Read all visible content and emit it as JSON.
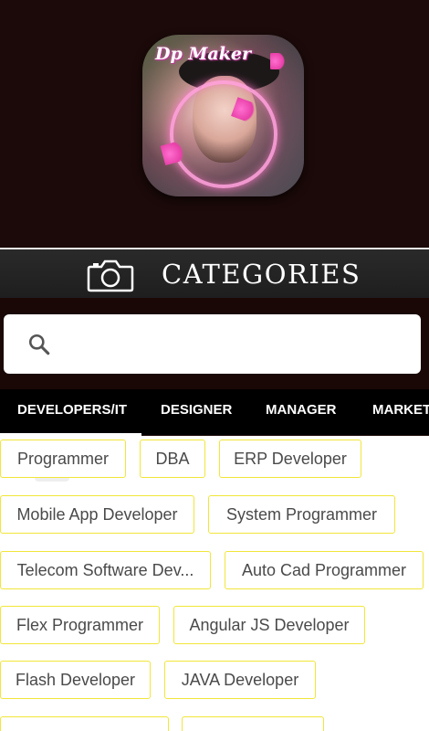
{
  "app_icon": {
    "logo_text": "Dp Maker"
  },
  "header_bar": {
    "title": "CATEGORIES"
  },
  "search": {
    "placeholder": "",
    "value": ""
  },
  "tabs": [
    {
      "label": "DEVELOPERS/IT",
      "selected": true
    },
    {
      "label": "DESIGNER",
      "selected": false
    },
    {
      "label": "MANAGER",
      "selected": false
    },
    {
      "label": "MARKETING",
      "selected": false
    }
  ],
  "chips": [
    "Programmer",
    "DBA",
    "ERP Developer",
    "Mobile App Developer",
    "System Programmer",
    "Telecom Software Dev...",
    "Auto Cad Programmer",
    "Flex Programmer",
    "Angular JS Developer",
    "Flash Developer",
    "JAVA Developer",
    "",
    ""
  ],
  "colors": {
    "header_bg": "#1b0a09",
    "chip_border": "#f1e63a",
    "tab_bg": "#000000",
    "tab_text": "#ffffff"
  }
}
